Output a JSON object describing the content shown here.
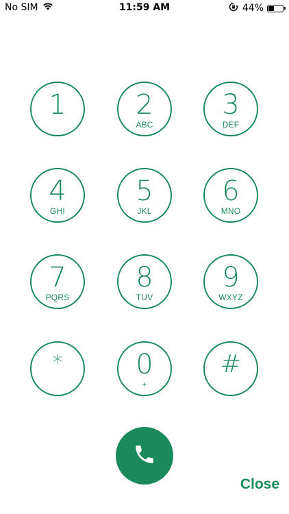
{
  "status_bar": {
    "carrier": "No SIM",
    "time": "11:59 AM",
    "battery_percent": "44%",
    "battery_level": 0.44,
    "icons": [
      "wifi-icon",
      "orientation-lock-icon",
      "battery-icon"
    ]
  },
  "keypad": {
    "keys": [
      {
        "digit": "1",
        "letters": ""
      },
      {
        "digit": "2",
        "letters": "ABC"
      },
      {
        "digit": "3",
        "letters": "DEF"
      },
      {
        "digit": "4",
        "letters": "GHI"
      },
      {
        "digit": "5",
        "letters": "JKL"
      },
      {
        "digit": "6",
        "letters": "MNO"
      },
      {
        "digit": "7",
        "letters": "PQRS"
      },
      {
        "digit": "8",
        "letters": "TUV"
      },
      {
        "digit": "9",
        "letters": "WXYZ"
      },
      {
        "digit": "*",
        "letters": ""
      },
      {
        "digit": "0",
        "letters": "+"
      },
      {
        "digit": "#",
        "letters": ""
      }
    ]
  },
  "call": {
    "icon": "phone-icon"
  },
  "close": {
    "label": "Close"
  },
  "colors": {
    "accent": "#1a8a5c",
    "background": "#ffffff",
    "status_text": "#000000"
  }
}
